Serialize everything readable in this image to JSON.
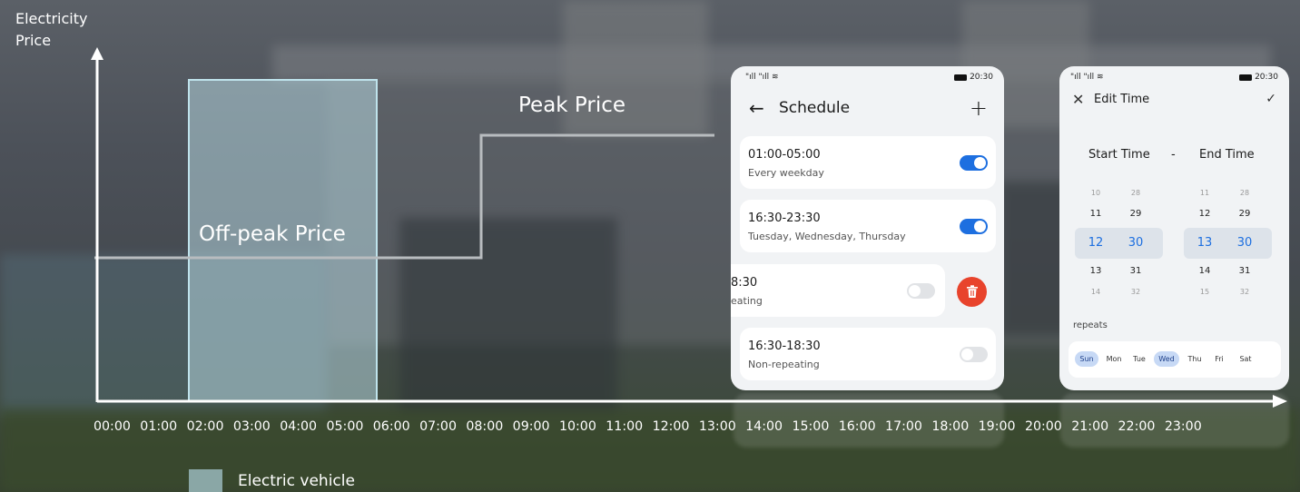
{
  "axis": {
    "y_title": "Electricity Price",
    "x_ticks": [
      "00:00",
      "01:00",
      "02:00",
      "03:00",
      "04:00",
      "05:00",
      "06:00",
      "07:00",
      "08:00",
      "09:00",
      "10:00",
      "11:00",
      "12:00",
      "13:00",
      "14:00",
      "15:00",
      "16:00",
      "17:00",
      "18:00",
      "19:00",
      "20:00",
      "21:00",
      "22:00",
      "23:00"
    ]
  },
  "labels": {
    "peak": "Peak Price",
    "offpeak": "Off-peak Price"
  },
  "legend": {
    "label": "Electric vehicle",
    "color": "#8aa7a6"
  },
  "price_curve": {
    "offpeak_until": "07:00",
    "peak_from": "07:00"
  },
  "ev_window": {
    "start": "02:00",
    "end": "05:00"
  },
  "phone_schedule": {
    "status_left": "\"ıll \"ıll ≋",
    "status_time": "20:30",
    "title": "Schedule",
    "back_icon": "←",
    "add_icon": "+",
    "items": [
      {
        "time": "01:00-05:00",
        "repeat": "Every weekday",
        "enabled": true
      },
      {
        "time": "16:30-23:30",
        "repeat": "Tuesday, Wednesday, Thursday",
        "enabled": true
      },
      {
        "time": "8:30",
        "repeat": "eating",
        "enabled": false
      },
      {
        "time": "16:30-18:30",
        "repeat": "Non-repeating",
        "enabled": false
      }
    ],
    "accent": "#1d6fe0",
    "delete_color": "#e8432c"
  },
  "phone_edit": {
    "status_left": "\"ıll \"ıll ≋",
    "status_time": "20:30",
    "close_icon": "✕",
    "title": "Edit Time",
    "confirm_icon": "✓",
    "start_label": "Start Time",
    "dash": "-",
    "end_label": "End Time",
    "start_hours": [
      "10",
      "11",
      "12",
      "13",
      "14"
    ],
    "start_minutes": [
      "28",
      "29",
      "30",
      "31",
      "32"
    ],
    "end_hours": [
      "11",
      "12",
      "13",
      "14",
      "15"
    ],
    "end_minutes": [
      "28",
      "29",
      "30",
      "31",
      "32"
    ],
    "repeats_label": "repeats",
    "days": [
      {
        "label": "Sun",
        "selected": true
      },
      {
        "label": "Mon",
        "selected": false
      },
      {
        "label": "Tue",
        "selected": false
      },
      {
        "label": "Wed",
        "selected": true
      },
      {
        "label": "Thu",
        "selected": false
      },
      {
        "label": "Fri",
        "selected": false
      },
      {
        "label": "Sat",
        "selected": false
      }
    ]
  }
}
